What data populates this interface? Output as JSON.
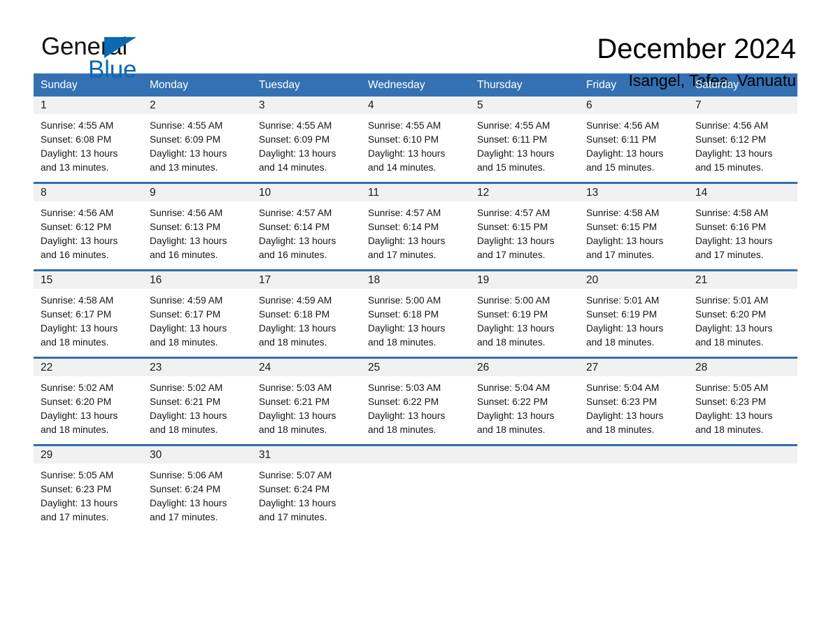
{
  "brand": {
    "word_one": "General",
    "word_two": "Blue",
    "triangle_icon": "triangle-icon",
    "accent_color": "#0b69b4"
  },
  "header": {
    "title": "December 2024",
    "location": "Isangel, Tafea, Vanuatu"
  },
  "theme": {
    "header_blue": "#3471b3",
    "separator_blue": "#2f6fae",
    "daynum_band": "#f1f1f1"
  },
  "calendar": {
    "weekdays": [
      "Sunday",
      "Monday",
      "Tuesday",
      "Wednesday",
      "Thursday",
      "Friday",
      "Saturday"
    ],
    "weeks": [
      [
        {
          "day": "1",
          "sunrise": "Sunrise: 4:55 AM",
          "sunset": "Sunset: 6:08 PM",
          "daylight_1": "Daylight: 13 hours",
          "daylight_2": "and 13 minutes."
        },
        {
          "day": "2",
          "sunrise": "Sunrise: 4:55 AM",
          "sunset": "Sunset: 6:09 PM",
          "daylight_1": "Daylight: 13 hours",
          "daylight_2": "and 13 minutes."
        },
        {
          "day": "3",
          "sunrise": "Sunrise: 4:55 AM",
          "sunset": "Sunset: 6:09 PM",
          "daylight_1": "Daylight: 13 hours",
          "daylight_2": "and 14 minutes."
        },
        {
          "day": "4",
          "sunrise": "Sunrise: 4:55 AM",
          "sunset": "Sunset: 6:10 PM",
          "daylight_1": "Daylight: 13 hours",
          "daylight_2": "and 14 minutes."
        },
        {
          "day": "5",
          "sunrise": "Sunrise: 4:55 AM",
          "sunset": "Sunset: 6:11 PM",
          "daylight_1": "Daylight: 13 hours",
          "daylight_2": "and 15 minutes."
        },
        {
          "day": "6",
          "sunrise": "Sunrise: 4:56 AM",
          "sunset": "Sunset: 6:11 PM",
          "daylight_1": "Daylight: 13 hours",
          "daylight_2": "and 15 minutes."
        },
        {
          "day": "7",
          "sunrise": "Sunrise: 4:56 AM",
          "sunset": "Sunset: 6:12 PM",
          "daylight_1": "Daylight: 13 hours",
          "daylight_2": "and 15 minutes."
        }
      ],
      [
        {
          "day": "8",
          "sunrise": "Sunrise: 4:56 AM",
          "sunset": "Sunset: 6:12 PM",
          "daylight_1": "Daylight: 13 hours",
          "daylight_2": "and 16 minutes."
        },
        {
          "day": "9",
          "sunrise": "Sunrise: 4:56 AM",
          "sunset": "Sunset: 6:13 PM",
          "daylight_1": "Daylight: 13 hours",
          "daylight_2": "and 16 minutes."
        },
        {
          "day": "10",
          "sunrise": "Sunrise: 4:57 AM",
          "sunset": "Sunset: 6:14 PM",
          "daylight_1": "Daylight: 13 hours",
          "daylight_2": "and 16 minutes."
        },
        {
          "day": "11",
          "sunrise": "Sunrise: 4:57 AM",
          "sunset": "Sunset: 6:14 PM",
          "daylight_1": "Daylight: 13 hours",
          "daylight_2": "and 17 minutes."
        },
        {
          "day": "12",
          "sunrise": "Sunrise: 4:57 AM",
          "sunset": "Sunset: 6:15 PM",
          "daylight_1": "Daylight: 13 hours",
          "daylight_2": "and 17 minutes."
        },
        {
          "day": "13",
          "sunrise": "Sunrise: 4:58 AM",
          "sunset": "Sunset: 6:15 PM",
          "daylight_1": "Daylight: 13 hours",
          "daylight_2": "and 17 minutes."
        },
        {
          "day": "14",
          "sunrise": "Sunrise: 4:58 AM",
          "sunset": "Sunset: 6:16 PM",
          "daylight_1": "Daylight: 13 hours",
          "daylight_2": "and 17 minutes."
        }
      ],
      [
        {
          "day": "15",
          "sunrise": "Sunrise: 4:58 AM",
          "sunset": "Sunset: 6:17 PM",
          "daylight_1": "Daylight: 13 hours",
          "daylight_2": "and 18 minutes."
        },
        {
          "day": "16",
          "sunrise": "Sunrise: 4:59 AM",
          "sunset": "Sunset: 6:17 PM",
          "daylight_1": "Daylight: 13 hours",
          "daylight_2": "and 18 minutes."
        },
        {
          "day": "17",
          "sunrise": "Sunrise: 4:59 AM",
          "sunset": "Sunset: 6:18 PM",
          "daylight_1": "Daylight: 13 hours",
          "daylight_2": "and 18 minutes."
        },
        {
          "day": "18",
          "sunrise": "Sunrise: 5:00 AM",
          "sunset": "Sunset: 6:18 PM",
          "daylight_1": "Daylight: 13 hours",
          "daylight_2": "and 18 minutes."
        },
        {
          "day": "19",
          "sunrise": "Sunrise: 5:00 AM",
          "sunset": "Sunset: 6:19 PM",
          "daylight_1": "Daylight: 13 hours",
          "daylight_2": "and 18 minutes."
        },
        {
          "day": "20",
          "sunrise": "Sunrise: 5:01 AM",
          "sunset": "Sunset: 6:19 PM",
          "daylight_1": "Daylight: 13 hours",
          "daylight_2": "and 18 minutes."
        },
        {
          "day": "21",
          "sunrise": "Sunrise: 5:01 AM",
          "sunset": "Sunset: 6:20 PM",
          "daylight_1": "Daylight: 13 hours",
          "daylight_2": "and 18 minutes."
        }
      ],
      [
        {
          "day": "22",
          "sunrise": "Sunrise: 5:02 AM",
          "sunset": "Sunset: 6:20 PM",
          "daylight_1": "Daylight: 13 hours",
          "daylight_2": "and 18 minutes."
        },
        {
          "day": "23",
          "sunrise": "Sunrise: 5:02 AM",
          "sunset": "Sunset: 6:21 PM",
          "daylight_1": "Daylight: 13 hours",
          "daylight_2": "and 18 minutes."
        },
        {
          "day": "24",
          "sunrise": "Sunrise: 5:03 AM",
          "sunset": "Sunset: 6:21 PM",
          "daylight_1": "Daylight: 13 hours",
          "daylight_2": "and 18 minutes."
        },
        {
          "day": "25",
          "sunrise": "Sunrise: 5:03 AM",
          "sunset": "Sunset: 6:22 PM",
          "daylight_1": "Daylight: 13 hours",
          "daylight_2": "and 18 minutes."
        },
        {
          "day": "26",
          "sunrise": "Sunrise: 5:04 AM",
          "sunset": "Sunset: 6:22 PM",
          "daylight_1": "Daylight: 13 hours",
          "daylight_2": "and 18 minutes."
        },
        {
          "day": "27",
          "sunrise": "Sunrise: 5:04 AM",
          "sunset": "Sunset: 6:23 PM",
          "daylight_1": "Daylight: 13 hours",
          "daylight_2": "and 18 minutes."
        },
        {
          "day": "28",
          "sunrise": "Sunrise: 5:05 AM",
          "sunset": "Sunset: 6:23 PM",
          "daylight_1": "Daylight: 13 hours",
          "daylight_2": "and 18 minutes."
        }
      ],
      [
        {
          "day": "29",
          "sunrise": "Sunrise: 5:05 AM",
          "sunset": "Sunset: 6:23 PM",
          "daylight_1": "Daylight: 13 hours",
          "daylight_2": "and 17 minutes."
        },
        {
          "day": "30",
          "sunrise": "Sunrise: 5:06 AM",
          "sunset": "Sunset: 6:24 PM",
          "daylight_1": "Daylight: 13 hours",
          "daylight_2": "and 17 minutes."
        },
        {
          "day": "31",
          "sunrise": "Sunrise: 5:07 AM",
          "sunset": "Sunset: 6:24 PM",
          "daylight_1": "Daylight: 13 hours",
          "daylight_2": "and 17 minutes."
        },
        {
          "day": "",
          "sunrise": "",
          "sunset": "",
          "daylight_1": "",
          "daylight_2": ""
        },
        {
          "day": "",
          "sunrise": "",
          "sunset": "",
          "daylight_1": "",
          "daylight_2": ""
        },
        {
          "day": "",
          "sunrise": "",
          "sunset": "",
          "daylight_1": "",
          "daylight_2": ""
        },
        {
          "day": "",
          "sunrise": "",
          "sunset": "",
          "daylight_1": "",
          "daylight_2": ""
        }
      ]
    ]
  }
}
